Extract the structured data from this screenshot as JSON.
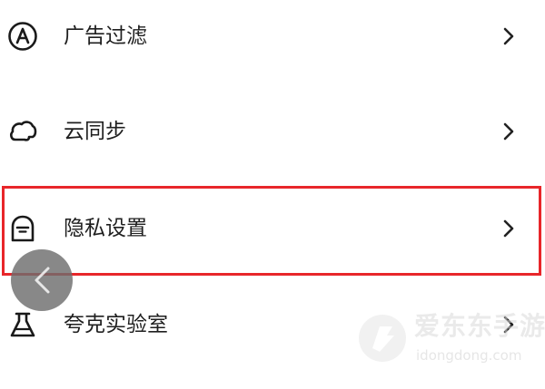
{
  "menu": {
    "items": [
      {
        "label": "广告过滤",
        "icon": "ad-block-icon"
      },
      {
        "label": "云同步",
        "icon": "cloud-icon"
      },
      {
        "label": "隐私设置",
        "icon": "privacy-mask-icon",
        "highlighted": true
      },
      {
        "label": "夸克实验室",
        "icon": "flask-icon"
      }
    ]
  },
  "overlay": {
    "back_icon": "chevron-left-icon",
    "highlight_color": "#e8262a"
  },
  "watermark": {
    "name": "爱东东手游",
    "url": "idongdong.com"
  }
}
